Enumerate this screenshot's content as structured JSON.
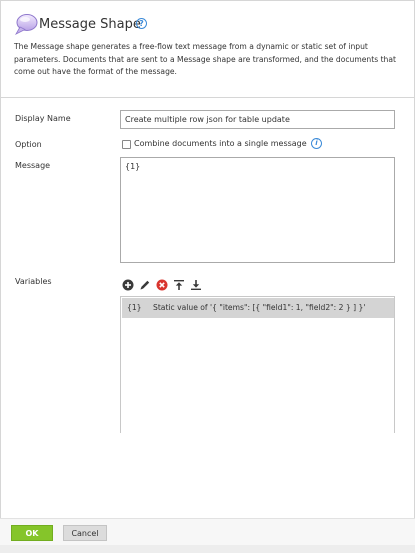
{
  "header": {
    "title": "Message Shape",
    "description": "The Message shape generates a free-flow text message from a dynamic or static set of input parameters. Documents that are sent to a Message shape are transformed, and the documents that come out have the format of the message."
  },
  "form": {
    "display_name_label": "Display Name",
    "display_name_value": "Create multiple row json for table update",
    "option_label": "Option",
    "option_checkbox_label": "Combine documents into a single message",
    "option_checked": false,
    "message_label": "Message",
    "message_value": "{1}",
    "variables_label": "Variables"
  },
  "variables": {
    "toolbar": [
      {
        "name": "add-icon"
      },
      {
        "name": "edit-icon"
      },
      {
        "name": "delete-icon"
      },
      {
        "name": "move-up-icon"
      },
      {
        "name": "move-down-icon"
      }
    ],
    "rows": [
      {
        "key": "{1}",
        "value": "Static value of '{ \"items\": [{ \"field1\": 1, \"field2\": 2 } ] }'"
      }
    ]
  },
  "footer": {
    "ok_label": "OK",
    "cancel_label": "Cancel"
  },
  "colors": {
    "ok_button": "#85c52a",
    "cancel_button": "#dcdcdc",
    "help_icon": "#3b8ad8",
    "delete_icon": "#d9352e",
    "selected_row": "#d4d4d4"
  }
}
